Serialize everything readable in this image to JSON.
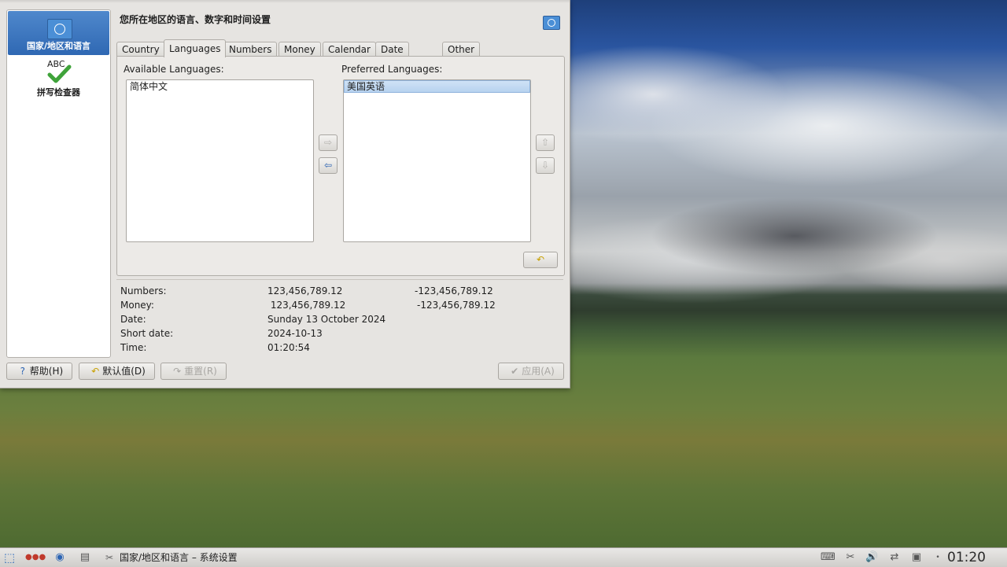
{
  "window": {
    "page_title": "您所在地区的语言、数字和时间设置"
  },
  "sidebar": {
    "items": [
      {
        "label": "国家/地区和语言",
        "icon": "un-flag-icon",
        "selected": true
      },
      {
        "label": "拼写检查器",
        "icon": "spellcheck-icon",
        "selected": false
      }
    ],
    "abc_text": "ABC"
  },
  "tabs": [
    {
      "label": "Country"
    },
    {
      "label": "Languages"
    },
    {
      "label": "Numbers"
    },
    {
      "label": "Money"
    },
    {
      "label": "Calendar"
    },
    {
      "label": "Date & Time"
    },
    {
      "label": "Other"
    }
  ],
  "active_tab": "Languages",
  "languages": {
    "available_label": "Available Languages:",
    "preferred_label": "Preferred Languages:",
    "available": [
      "简体中文"
    ],
    "preferred": [
      "美国英语"
    ]
  },
  "summary": {
    "numbers": {
      "label": "Numbers:",
      "positive": "123,456,789.12",
      "negative": "-123,456,789.12"
    },
    "money": {
      "label": "Money:",
      "positive": " 123,456,789.12",
      "negative": "-123,456,789.12"
    },
    "date": {
      "label": "Date:",
      "value": "Sunday 13 October 2024"
    },
    "short_date": {
      "label": "Short date:",
      "value": "2024-10-13"
    },
    "time": {
      "label": "Time:",
      "value": "01:20:54"
    }
  },
  "buttons": {
    "help": "帮助(H)",
    "defaults": "默认值(D)",
    "reset": "重置(R)",
    "apply": "应用(A)"
  },
  "taskbar": {
    "task_title": "国家/地区和语言 – 系统设置",
    "clock": "01:20"
  },
  "colors": {
    "selection": "#3a74bf",
    "window_bg": "#e6e4e1"
  }
}
